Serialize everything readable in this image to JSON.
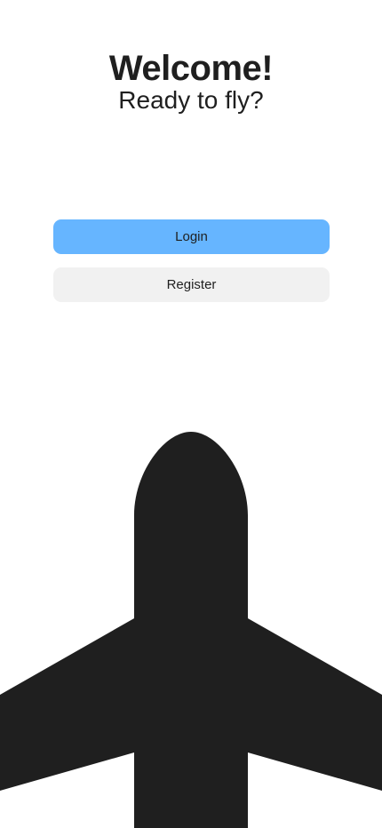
{
  "header": {
    "title": "Welcome!",
    "subtitle": "Ready to fly?"
  },
  "actions": {
    "login_label": "Login",
    "register_label": "Register"
  },
  "illustration": {
    "icon": "airplane-icon",
    "color": "#1f1f1f"
  },
  "colors": {
    "primary": "#66b5ff",
    "secondary": "#f1f1f1",
    "text": "#1f1f1f",
    "background": "#ffffff"
  }
}
